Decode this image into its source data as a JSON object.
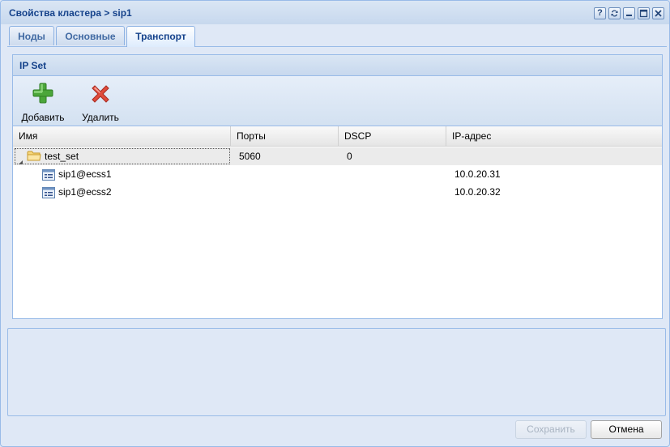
{
  "window": {
    "title": "Свойства кластера > sip1",
    "tools": [
      "help-icon",
      "refresh-icon",
      "minimize-icon",
      "maximize-icon",
      "close-icon"
    ]
  },
  "tabs": [
    {
      "label": "Ноды",
      "active": false
    },
    {
      "label": "Основные",
      "active": false
    },
    {
      "label": "Транспорт",
      "active": true
    }
  ],
  "ipset": {
    "title": "IP Set",
    "toolbar": {
      "add_label": "Добавить",
      "delete_label": "Удалить"
    },
    "columns": [
      "Имя",
      "Порты",
      "DSCP",
      "IP-адрес"
    ],
    "group": {
      "name": "test_set",
      "ports": "5060",
      "dscp": "0",
      "ip": ""
    },
    "rows": [
      {
        "name": "sip1@ecss1",
        "ports": "",
        "dscp": "",
        "ip": "10.0.20.31"
      },
      {
        "name": "sip1@ecss2",
        "ports": "",
        "dscp": "",
        "ip": "10.0.20.32"
      }
    ]
  },
  "footer": {
    "save_label": "Сохранить",
    "cancel_label": "Отмена"
  },
  "colors": {
    "title_text": "#15428b",
    "panel_border": "#99bbe8",
    "window_bg": "#dfe8f6"
  }
}
